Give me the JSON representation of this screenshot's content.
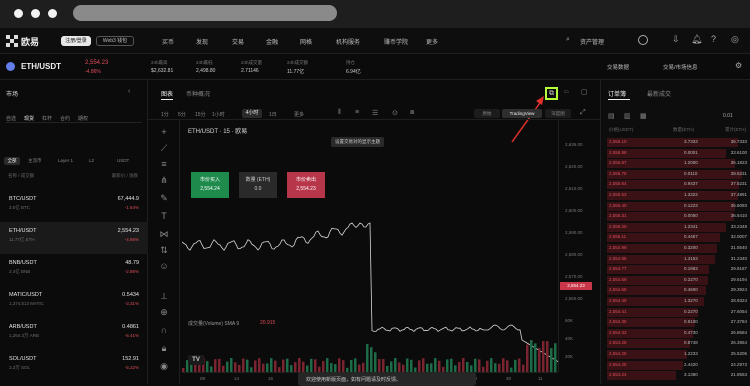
{
  "nav": {
    "logo": "欧易",
    "btn_primary": "注册/登录",
    "btn_secondary": "Web3 钱包",
    "items": [
      "买币",
      "发现",
      "交易",
      "金融",
      "网格",
      "机构服务",
      "赚币学院",
      "更多"
    ],
    "right_button": "资产管理"
  },
  "ticker": {
    "pair": "ETH/USDT",
    "price": "2,554.23",
    "change": "-4.86%",
    "stats": [
      {
        "label": "24h最高",
        "value": "$2,632.81"
      },
      {
        "label": "24h最低",
        "value": "2,498.80"
      },
      {
        "label": "24h成交量",
        "value": "2.71146"
      },
      {
        "label": "24h成交额",
        "value": "11.77亿"
      },
      {
        "label": "持仓",
        "value": "6.94亿"
      }
    ],
    "right_links": [
      "交易数据",
      "交易/市场信息"
    ]
  },
  "left": {
    "title": "市场",
    "tabs": [
      "自选",
      "现货",
      "杠杆",
      "合约",
      "期权"
    ],
    "filters": [
      "全部",
      "主流币",
      "Layer 1",
      "L2"
    ],
    "quote": "USDT",
    "col_headers": [
      "名称 / 成交额",
      "最新价 / 涨跌"
    ],
    "rows": [
      {
        "name": "BTC/USDT",
        "sub": "3.5亿 BTC",
        "price": "67,444.9",
        "change": "-1.64%"
      },
      {
        "name": "ETH/USDT",
        "sub": "11.77亿 ETH",
        "price": "2,554.23",
        "change": "-4.86%"
      },
      {
        "name": "BNB/USDT",
        "sub": "2.4亿 BNB",
        "price": "48.79",
        "change": "-2.86%"
      },
      {
        "name": "MATIC/USDT",
        "sub": "1,374,513 MATIC",
        "price": "0.5434",
        "change": "-3.31%"
      },
      {
        "name": "ARB/USDT",
        "sub": "1,254.3万 ARB",
        "price": "0.4861",
        "change": "-6.41%"
      },
      {
        "name": "SOL/USDT",
        "sub": "3.3万 SOL",
        "price": "152.91",
        "change": "-5.22%"
      }
    ]
  },
  "center": {
    "tabs": [
      "图表",
      "币种概况"
    ],
    "intervals": [
      "1分",
      "5分",
      "15分",
      "1小时",
      "4小时",
      "1日",
      "更多"
    ],
    "view_modes": [
      "原始",
      "TradingView",
      "深度图"
    ],
    "chart_title": "ETH/USDT · 15 · 欧易",
    "tooltip": "设置交易对的显示主题",
    "volume_label": "成交量(Volume) SMA 9",
    "volume_value": "20.915",
    "order_buttons": [
      {
        "label": "市价买入",
        "price": "2,554.24"
      },
      {
        "label": "数量 (ETH)",
        "price": "0.0"
      },
      {
        "label": "市价卖出",
        "price": "2,554.23"
      }
    ],
    "y_ticks": [
      "2,636.00",
      "2,620.00",
      "2,610.00",
      "2,600.00",
      "2,590.00",
      "2,580.00",
      "2,570.00",
      "2,560.00"
    ],
    "last_price_tag": "2,554.23",
    "vol_ticks": [
      "60K",
      "40K",
      "20K"
    ],
    "x_ticks": [
      "08",
      "14",
      "16",
      "18",
      "20",
      "22",
      "24",
      "26",
      "28",
      "30",
      "11"
    ],
    "toast": "欢迎使用新版页面，如有问题请及时反馈。",
    "tv_logo": "TV"
  },
  "orderbook": {
    "tabs": [
      "订单簿",
      "最新成交"
    ],
    "depth": "0.01",
    "headers": [
      "价格(USDT)",
      "数量(ETH)",
      "累计(ETH)"
    ],
    "rows": [
      {
        "price": "2,556.10",
        "qty": "3.7333",
        "total": "36.7333",
        "w": 0.95
      },
      {
        "price": "2,555.98",
        "qty": "0.0001",
        "total": "33.6100",
        "w": 0.86
      },
      {
        "price": "2,555.87",
        "qty": "1.2000",
        "total": "36.1823",
        "w": 0.93
      },
      {
        "price": "2,555.76",
        "qty": "0.0110",
        "total": "38.5231",
        "w": 0.98
      },
      {
        "price": "2,555.64",
        "qty": "0.9437",
        "total": "37.5231",
        "w": 0.96
      },
      {
        "price": "2,555.53",
        "qty": "1.3322",
        "total": "37.4891",
        "w": 0.95
      },
      {
        "price": "2,555.40",
        "qty": "0.1223",
        "total": "36.6093",
        "w": 0.93
      },
      {
        "price": "2,555.31",
        "qty": "0.0050",
        "total": "36.5410",
        "w": 0.92
      },
      {
        "price": "2,555.20",
        "qty": "1.2341",
        "total": "33.2348",
        "w": 0.86
      },
      {
        "price": "2,555.11",
        "qty": "0.4467",
        "total": "32.0007",
        "w": 0.82
      },
      {
        "price": "2,554.99",
        "qty": "0.3200",
        "total": "31.5540",
        "w": 0.8
      },
      {
        "price": "2,554.88",
        "qty": "1.4153",
        "total": "31.2340",
        "w": 0.78
      },
      {
        "price": "2,554.77",
        "qty": "0.1993",
        "total": "29.8187",
        "w": 0.74
      },
      {
        "price": "2,554.69",
        "qty": "0.2270",
        "total": "29.6194",
        "w": 0.73
      },
      {
        "price": "2,554.58",
        "qty": "0.4600",
        "total": "29.3924",
        "w": 0.72
      },
      {
        "price": "2,554.49",
        "qty": "1.3270",
        "total": "28.9324",
        "w": 0.7
      },
      {
        "price": "2,554.41",
        "qty": "0.2270",
        "total": "27.6054",
        "w": 0.66
      },
      {
        "price": "2,554.36",
        "qty": "0.5100",
        "total": "27.3784",
        "w": 0.64
      },
      {
        "price": "2,554.32",
        "qty": "0.4730",
        "total": "26.8684",
        "w": 0.62
      },
      {
        "price": "2,554.28",
        "qty": "0.8748",
        "total": "26.3954",
        "w": 0.6
      },
      {
        "price": "2,554.26",
        "qty": "1.2233",
        "total": "25.5206",
        "w": 0.58
      },
      {
        "price": "2,554.25",
        "qty": "2.4420",
        "total": "24.2973",
        "w": 0.55
      },
      {
        "price": "2,554.24",
        "qty": "3.1380",
        "total": "21.8553",
        "w": 0.5
      }
    ]
  },
  "colors": {
    "up": "#22a06b",
    "down": "#e04d5a",
    "highlight": "#b4ff3a",
    "arrow": "#e0312b"
  }
}
